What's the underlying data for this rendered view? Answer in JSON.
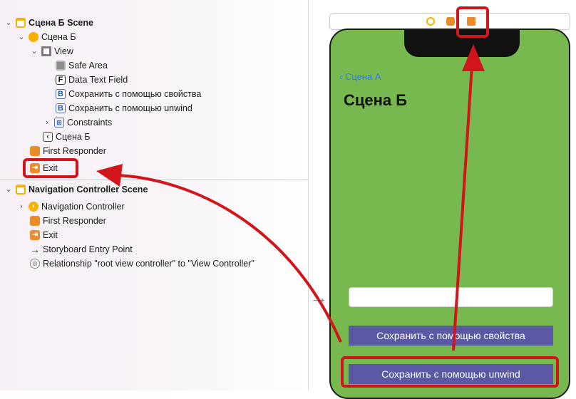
{
  "outline": {
    "scene_b": {
      "title": "Сцена Б Scene",
      "controller": "Сцена Б",
      "view": "View",
      "safe_area": "Safe Area",
      "text_field": "Data Text Field",
      "button_property": "Сохранить с помощью свойства",
      "button_unwind": "Сохранить с помощью unwind",
      "constraints": "Constraints",
      "nav_item": "Сцена Б",
      "first_responder": "First Responder",
      "exit": "Exit"
    },
    "nav_scene": {
      "title": "Navigation Controller Scene",
      "controller": "Navigation Controller",
      "first_responder": "First Responder",
      "exit": "Exit",
      "entry_point": "Storyboard Entry Point",
      "relationship": "Relationship \"root view controller\" to \"View Controller\""
    }
  },
  "canvas": {
    "back_label": "Сцена А",
    "title": "Сцена Б",
    "button_property": "Сохранить с помощью свойства",
    "button_unwind": "Сохранить с помощью unwind"
  },
  "colors": {
    "highlight": "#d2141b",
    "scene_background": "#77b84f",
    "button": "#5b59a4",
    "link": "#2f7cf6"
  },
  "icons": {
    "scene": "scene-icon",
    "view_controller": "view-controller-icon",
    "view": "view-icon",
    "safe_area": "safe-area-icon",
    "text_field": "text-field-icon",
    "button": "button-icon",
    "constraints": "constraints-icon",
    "navigation_item": "navigation-item-icon",
    "first_responder": "first-responder-icon",
    "exit": "exit-icon",
    "entry_point": "arrow-right-icon",
    "relationship": "relationship-icon"
  }
}
